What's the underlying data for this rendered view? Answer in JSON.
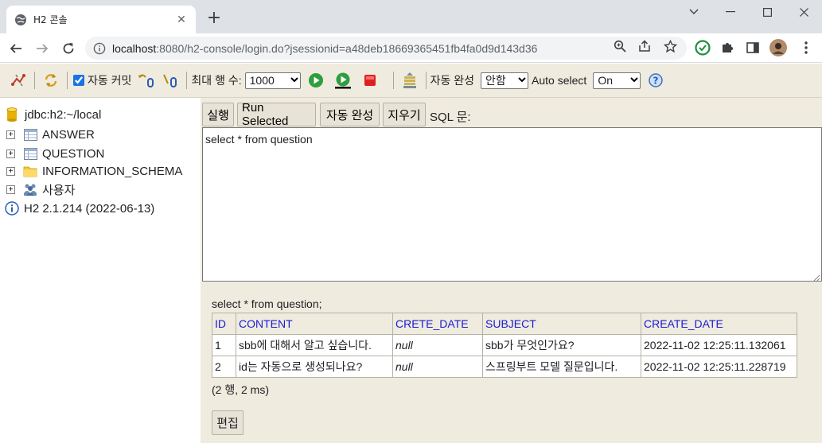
{
  "browser": {
    "tab_title": "H2 콘솔",
    "tab_close": "✕",
    "new_tab": "+",
    "url_host": "localhost",
    "url_rest": ":8080/h2-console/login.do?jsessionid=a48deb18669365451fb4fa0d9d143d36"
  },
  "toolbar": {
    "autocommit_label": "자동 커밋",
    "autocommit_checked": true,
    "maxrows_label": "최대 행 수:",
    "maxrows_value": "1000",
    "autocomplete_label": "자동 완성",
    "autocomplete_value": "안함",
    "autoselect_label": "Auto select",
    "autoselect_value": "On"
  },
  "tree": {
    "connection": "jdbc:h2:~/local",
    "items": [
      {
        "label": "ANSWER",
        "icon": "table-icon"
      },
      {
        "label": "QUESTION",
        "icon": "table-icon"
      },
      {
        "label": "INFORMATION_SCHEMA",
        "icon": "folder-icon"
      },
      {
        "label": "사용자",
        "icon": "users-icon"
      }
    ],
    "version": "H2 2.1.214 (2022-06-13)"
  },
  "query": {
    "run_button": "실행",
    "run_selected_button": "Run Selected",
    "autocomplete_button": "자동 완성",
    "clear_button": "지우기",
    "sql_label": "SQL 문:",
    "sql_text": "select * from question"
  },
  "result": {
    "statement": "select * from question;",
    "columns": [
      "ID",
      "CONTENT",
      "CRETE_DATE",
      "SUBJECT",
      "CREATE_DATE"
    ],
    "rows": [
      [
        "1",
        "sbb에 대해서 알고 싶습니다.",
        "null",
        "sbb가 무엇인가요?",
        "2022-11-02 12:25:11.132061"
      ],
      [
        "2",
        "id는 자동으로 생성되나요?",
        "null",
        "스프링부트 모델 질문입니다.",
        "2022-11-02 12:25:11.228719"
      ]
    ],
    "row_count": "(2 행, 2 ms)",
    "edit_button": "편집"
  },
  "colors": {
    "panel_bg": "#efebde",
    "header_text": "#1a1ad6",
    "chrome_bg": "#dee1e6"
  }
}
